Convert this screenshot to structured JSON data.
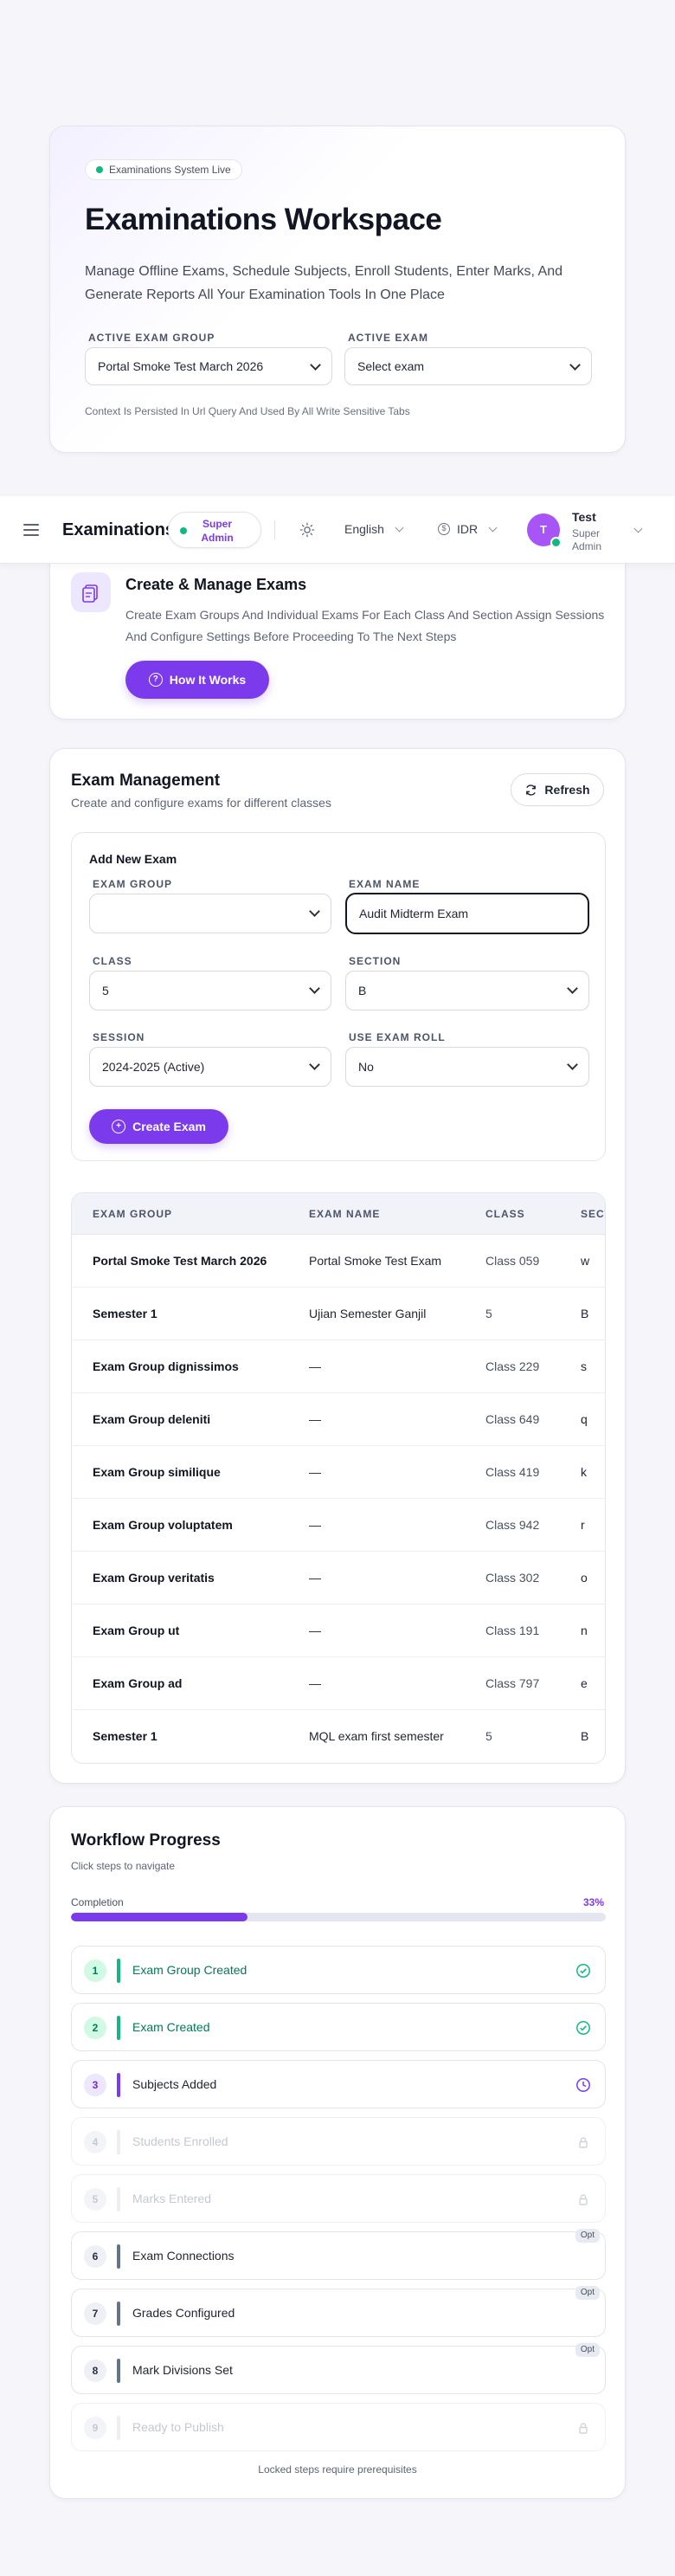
{
  "hero": {
    "badge": "Examinations System Live",
    "title": "Examinations Workspace",
    "subtitle": "Manage Offline Exams, Schedule Subjects, Enroll Students, Enter Marks, And Generate Reports All Your Examination Tools In One Place",
    "exam_group_label": "ACTIVE EXAM GROUP",
    "exam_group_value": "Portal Smoke Test March 2026",
    "exam_label": "ACTIVE EXAM",
    "exam_value": "Select exam",
    "note": "Context Is Persisted In Url Query And Used By All Write Sensitive Tabs"
  },
  "nav": {
    "title": "Examinations",
    "role": "Super Admin",
    "language": "English",
    "currency": "IDR",
    "avatar_initial": "T",
    "user_name": "Test",
    "user_role": "Super Admin"
  },
  "how": {
    "title": "Create & Manage Exams",
    "text": "Create Exam Groups And Individual Exams For Each Class And Section Assign Sessions And Configure Settings Before Proceeding To The Next Steps",
    "button": "How It Works"
  },
  "management": {
    "title": "Exam Management",
    "subtitle": "Create and configure exams for different classes",
    "refresh": "Refresh",
    "form": {
      "heading": "Add New Exam",
      "exam_group_label": "EXAM GROUP",
      "exam_group_value": "",
      "exam_name_label": "EXAM NAME",
      "exam_name_value": "Audit Midterm Exam",
      "class_label": "CLASS",
      "class_value": "5",
      "section_label": "SECTION",
      "section_value": "B",
      "session_label": "SESSION",
      "session_value": "2024-2025 (Active)",
      "exam_roll_label": "USE EXAM ROLL",
      "exam_roll_value": "No",
      "create_button": "Create Exam"
    },
    "table": {
      "headers": [
        "EXAM GROUP",
        "EXAM NAME",
        "CLASS",
        "SECTION"
      ],
      "rows": [
        [
          "Portal Smoke Test March 2026",
          "Portal Smoke Test Exam",
          "Class 059",
          "w"
        ],
        [
          "Semester 1",
          "Ujian Semester Ganjil",
          "5",
          "B"
        ],
        [
          "Exam Group dignissimos",
          "—",
          "Class 229",
          "s"
        ],
        [
          "Exam Group deleniti",
          "—",
          "Class 649",
          "q"
        ],
        [
          "Exam Group similique",
          "—",
          "Class 419",
          "k"
        ],
        [
          "Exam Group voluptatem",
          "—",
          "Class 942",
          "r"
        ],
        [
          "Exam Group veritatis",
          "—",
          "Class 302",
          "o"
        ],
        [
          "Exam Group ut",
          "—",
          "Class 191",
          "n"
        ],
        [
          "Exam Group ad",
          "—",
          "Class 797",
          "e"
        ],
        [
          "Semester 1",
          "MQL exam first semester",
          "5",
          "B"
        ]
      ]
    }
  },
  "workflow": {
    "title": "Workflow Progress",
    "subtitle": "Click steps to navigate",
    "completion_label": "Completion",
    "completion_percent": "33%",
    "completion_fraction": 0.33,
    "optional_badge": "Opt",
    "steps": [
      {
        "number": "1",
        "label": "Exam Group Created",
        "state": "done"
      },
      {
        "number": "2",
        "label": "Exam Created",
        "state": "done"
      },
      {
        "number": "3",
        "label": "Subjects Added",
        "state": "current"
      },
      {
        "number": "4",
        "label": "Students Enrolled",
        "state": "locked"
      },
      {
        "number": "5",
        "label": "Marks Entered",
        "state": "locked"
      },
      {
        "number": "6",
        "label": "Exam Connections",
        "state": "optional"
      },
      {
        "number": "7",
        "label": "Grades Configured",
        "state": "optional"
      },
      {
        "number": "8",
        "label": "Mark Divisions Set",
        "state": "optional"
      },
      {
        "number": "9",
        "label": "Ready to Publish",
        "state": "locked"
      }
    ],
    "footer": "Locked steps require prerequisites"
  },
  "colors": {
    "accent": "#7c3aed",
    "success": "#10b981",
    "muted": "#c4c8d2"
  }
}
